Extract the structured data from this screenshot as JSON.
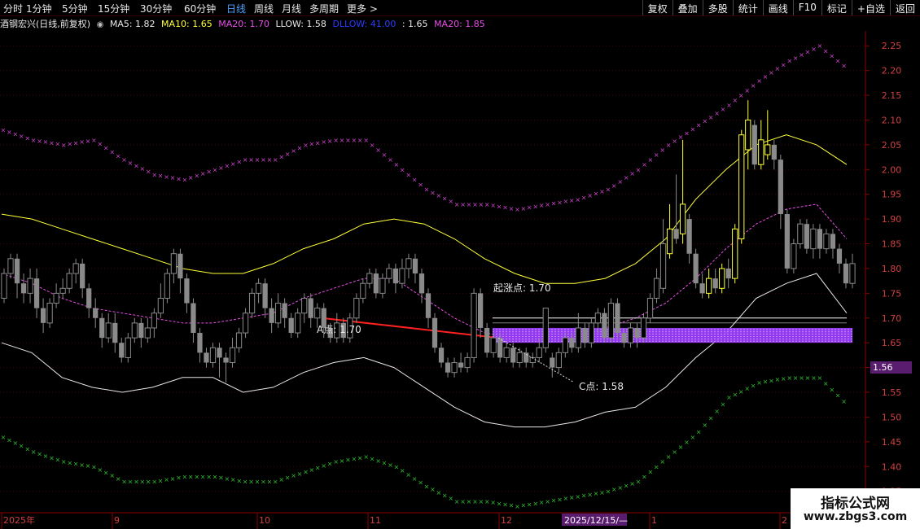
{
  "toolbar": {
    "periods": [
      "分时",
      "1分钟",
      "5分钟",
      "15分钟",
      "30分钟",
      "60分钟",
      "日线",
      "周线",
      "月线",
      "多周期",
      "更多 >"
    ],
    "active_period": "日线",
    "right_buttons": [
      "复权",
      "叠加",
      "多股",
      "统计",
      "画线",
      "F10",
      "标记",
      "+自选",
      "返回"
    ]
  },
  "info": {
    "stock": "酒钢宏兴(日线,前复权)",
    "ma5": "MA5: 1.82",
    "ma10": "MA10: 1.65",
    "ma20": "MA20: 1.70",
    "llow": "LLOW: 1.58",
    "dllow": "DLLOW: 41.00",
    "extra": ": 1.65",
    "ma20b": "MA20: 1.85"
  },
  "colors": {
    "ma5": "#e8e8e8",
    "ma10": "#ffff3a",
    "ma20": "#e84ee8",
    "llow": "#e8e8e8",
    "dllow": "#2b3cff",
    "ma20b": "#e84ee8",
    "up": "#ffff3a",
    "down": "#8a8a8a",
    "red_line": "#ff2020",
    "band": "#9b3cff",
    "axis": "#8b0000"
  },
  "price_axis": {
    "ticks": [
      "2.25",
      "2.20",
      "2.15",
      "2.10",
      "2.05",
      "2.00",
      "1.95",
      "1.90",
      "1.85",
      "1.80",
      "1.75",
      "1.70",
      "1.65",
      "1.60",
      "1.55",
      "1.50",
      "1.45",
      "1.40",
      "1.35"
    ],
    "cursor_value": "1.56"
  },
  "date_axis": {
    "labels": [
      "2025年",
      "9",
      "10",
      "11",
      "12",
      "1",
      "2"
    ],
    "highlight": "2025/12/15/—"
  },
  "annotations": {
    "a_point": "A点: 1.70",
    "c_point": "C点: 1.58",
    "start_point": "起涨点: 1.70"
  },
  "watermark": {
    "line1": "指标公式网",
    "line2": "www.zbgs3.com"
  },
  "chart_data": {
    "type": "candlestick",
    "y_range": [
      1.31,
      2.28
    ],
    "levels": {
      "start_line": 1.7,
      "band_low": 1.65,
      "band_high": 1.68
    },
    "candles": [
      {
        "o": 1.74,
        "c": 1.79,
        "h": 1.8,
        "l": 1.73
      },
      {
        "o": 1.79,
        "c": 1.82,
        "h": 1.83,
        "l": 1.78
      },
      {
        "o": 1.82,
        "c": 1.77,
        "h": 1.83,
        "l": 1.74
      },
      {
        "o": 1.77,
        "c": 1.75,
        "h": 1.79,
        "l": 1.73
      },
      {
        "o": 1.75,
        "c": 1.78,
        "h": 1.8,
        "l": 1.73
      },
      {
        "o": 1.78,
        "c": 1.72,
        "h": 1.8,
        "l": 1.7
      },
      {
        "o": 1.72,
        "c": 1.69,
        "h": 1.74,
        "l": 1.67
      },
      {
        "o": 1.69,
        "c": 1.73,
        "h": 1.74,
        "l": 1.68
      },
      {
        "o": 1.73,
        "c": 1.75,
        "h": 1.77,
        "l": 1.72
      },
      {
        "o": 1.75,
        "c": 1.76,
        "h": 1.78,
        "l": 1.74
      },
      {
        "o": 1.76,
        "c": 1.79,
        "h": 1.8,
        "l": 1.75
      },
      {
        "o": 1.79,
        "c": 1.81,
        "h": 1.82,
        "l": 1.77
      },
      {
        "o": 1.81,
        "c": 1.76,
        "h": 1.82,
        "l": 1.74
      },
      {
        "o": 1.76,
        "c": 1.72,
        "h": 1.77,
        "l": 1.7
      },
      {
        "o": 1.72,
        "c": 1.7,
        "h": 1.74,
        "l": 1.68
      },
      {
        "o": 1.7,
        "c": 1.66,
        "h": 1.71,
        "l": 1.64
      },
      {
        "o": 1.66,
        "c": 1.69,
        "h": 1.71,
        "l": 1.65
      },
      {
        "o": 1.69,
        "c": 1.65,
        "h": 1.71,
        "l": 1.63
      },
      {
        "o": 1.65,
        "c": 1.62,
        "h": 1.66,
        "l": 1.61
      },
      {
        "o": 1.62,
        "c": 1.66,
        "h": 1.67,
        "l": 1.61
      },
      {
        "o": 1.66,
        "c": 1.69,
        "h": 1.7,
        "l": 1.65
      },
      {
        "o": 1.69,
        "c": 1.66,
        "h": 1.7,
        "l": 1.64
      },
      {
        "o": 1.66,
        "c": 1.68,
        "h": 1.7,
        "l": 1.65
      },
      {
        "o": 1.68,
        "c": 1.71,
        "h": 1.72,
        "l": 1.66
      },
      {
        "o": 1.71,
        "c": 1.74,
        "h": 1.77,
        "l": 1.7
      },
      {
        "o": 1.74,
        "c": 1.79,
        "h": 1.8,
        "l": 1.73
      },
      {
        "o": 1.79,
        "c": 1.83,
        "h": 1.84,
        "l": 1.77
      },
      {
        "o": 1.83,
        "c": 1.78,
        "h": 1.84,
        "l": 1.75
      },
      {
        "o": 1.78,
        "c": 1.73,
        "h": 1.79,
        "l": 1.71
      },
      {
        "o": 1.73,
        "c": 1.67,
        "h": 1.74,
        "l": 1.65
      },
      {
        "o": 1.67,
        "c": 1.63,
        "h": 1.68,
        "l": 1.61
      },
      {
        "o": 1.63,
        "c": 1.61,
        "h": 1.64,
        "l": 1.6
      },
      {
        "o": 1.61,
        "c": 1.64,
        "h": 1.65,
        "l": 1.6
      },
      {
        "o": 1.64,
        "c": 1.62,
        "h": 1.65,
        "l": 1.58
      },
      {
        "o": 1.62,
        "c": 1.61,
        "h": 1.63,
        "l": 1.57
      },
      {
        "o": 1.61,
        "c": 1.64,
        "h": 1.66,
        "l": 1.6
      },
      {
        "o": 1.64,
        "c": 1.67,
        "h": 1.68,
        "l": 1.63
      },
      {
        "o": 1.67,
        "c": 1.71,
        "h": 1.72,
        "l": 1.66
      },
      {
        "o": 1.71,
        "c": 1.75,
        "h": 1.76,
        "l": 1.7
      },
      {
        "o": 1.75,
        "c": 1.77,
        "h": 1.78,
        "l": 1.73
      },
      {
        "o": 1.77,
        "c": 1.72,
        "h": 1.78,
        "l": 1.7
      },
      {
        "o": 1.72,
        "c": 1.69,
        "h": 1.74,
        "l": 1.67
      },
      {
        "o": 1.69,
        "c": 1.73,
        "h": 1.75,
        "l": 1.68
      },
      {
        "o": 1.73,
        "c": 1.7,
        "h": 1.74,
        "l": 1.68
      },
      {
        "o": 1.7,
        "c": 1.67,
        "h": 1.71,
        "l": 1.66
      },
      {
        "o": 1.67,
        "c": 1.71,
        "h": 1.72,
        "l": 1.66
      },
      {
        "o": 1.71,
        "c": 1.74,
        "h": 1.75,
        "l": 1.69
      },
      {
        "o": 1.74,
        "c": 1.7,
        "h": 1.75,
        "l": 1.68
      },
      {
        "o": 1.7,
        "c": 1.72,
        "h": 1.73,
        "l": 1.68
      },
      {
        "o": 1.72,
        "c": 1.68,
        "h": 1.73,
        "l": 1.66
      },
      {
        "o": 1.68,
        "c": 1.66,
        "h": 1.69,
        "l": 1.65
      },
      {
        "o": 1.66,
        "c": 1.69,
        "h": 1.71,
        "l": 1.65
      },
      {
        "o": 1.69,
        "c": 1.66,
        "h": 1.7,
        "l": 1.65
      },
      {
        "o": 1.66,
        "c": 1.7,
        "h": 1.71,
        "l": 1.65
      },
      {
        "o": 1.7,
        "c": 1.74,
        "h": 1.75,
        "l": 1.69
      },
      {
        "o": 1.74,
        "c": 1.77,
        "h": 1.78,
        "l": 1.73
      },
      {
        "o": 1.77,
        "c": 1.79,
        "h": 1.8,
        "l": 1.76
      },
      {
        "o": 1.79,
        "c": 1.75,
        "h": 1.8,
        "l": 1.74
      },
      {
        "o": 1.75,
        "c": 1.78,
        "h": 1.79,
        "l": 1.74
      },
      {
        "o": 1.78,
        "c": 1.8,
        "h": 1.81,
        "l": 1.77
      },
      {
        "o": 1.8,
        "c": 1.77,
        "h": 1.81,
        "l": 1.75
      },
      {
        "o": 1.77,
        "c": 1.8,
        "h": 1.82,
        "l": 1.76
      },
      {
        "o": 1.8,
        "c": 1.82,
        "h": 1.83,
        "l": 1.78
      },
      {
        "o": 1.82,
        "c": 1.79,
        "h": 1.83,
        "l": 1.77
      },
      {
        "o": 1.79,
        "c": 1.75,
        "h": 1.8,
        "l": 1.73
      },
      {
        "o": 1.75,
        "c": 1.7,
        "h": 1.76,
        "l": 1.68
      },
      {
        "o": 1.7,
        "c": 1.64,
        "h": 1.71,
        "l": 1.63
      },
      {
        "o": 1.64,
        "c": 1.61,
        "h": 1.65,
        "l": 1.6
      },
      {
        "o": 1.61,
        "c": 1.59,
        "h": 1.62,
        "l": 1.58
      },
      {
        "o": 1.59,
        "c": 1.61,
        "h": 1.62,
        "l": 1.58
      },
      {
        "o": 1.61,
        "c": 1.6,
        "h": 1.63,
        "l": 1.59
      },
      {
        "o": 1.6,
        "c": 1.62,
        "h": 1.63,
        "l": 1.59
      },
      {
        "o": 1.62,
        "c": 1.75,
        "h": 1.76,
        "l": 1.61
      },
      {
        "o": 1.75,
        "c": 1.68,
        "h": 1.76,
        "l": 1.66
      },
      {
        "o": 1.68,
        "c": 1.63,
        "h": 1.69,
        "l": 1.62
      },
      {
        "o": 1.63,
        "c": 1.66,
        "h": 1.67,
        "l": 1.62
      },
      {
        "o": 1.66,
        "c": 1.62,
        "h": 1.67,
        "l": 1.61
      },
      {
        "o": 1.62,
        "c": 1.64,
        "h": 1.65,
        "l": 1.61
      },
      {
        "o": 1.64,
        "c": 1.61,
        "h": 1.65,
        "l": 1.6
      },
      {
        "o": 1.61,
        "c": 1.63,
        "h": 1.64,
        "l": 1.6
      },
      {
        "o": 1.63,
        "c": 1.61,
        "h": 1.64,
        "l": 1.6
      },
      {
        "o": 1.61,
        "c": 1.62,
        "h": 1.63,
        "l": 1.6
      },
      {
        "o": 1.62,
        "c": 1.64,
        "h": 1.66,
        "l": 1.61
      },
      {
        "o": 1.64,
        "c": 1.72,
        "h": 1.72,
        "l": 1.63
      },
      {
        "o": 1.62,
        "c": 1.6,
        "h": 1.63,
        "l": 1.58
      },
      {
        "o": 1.6,
        "c": 1.63,
        "h": 1.64,
        "l": 1.59
      },
      {
        "o": 1.63,
        "c": 1.66,
        "h": 1.67,
        "l": 1.62
      },
      {
        "o": 1.66,
        "c": 1.64,
        "h": 1.67,
        "l": 1.63
      },
      {
        "o": 1.64,
        "c": 1.68,
        "h": 1.71,
        "l": 1.63
      },
      {
        "o": 1.68,
        "c": 1.65,
        "h": 1.69,
        "l": 1.64
      },
      {
        "o": 1.65,
        "c": 1.69,
        "h": 1.7,
        "l": 1.64
      },
      {
        "o": 1.69,
        "c": 1.71,
        "h": 1.72,
        "l": 1.67
      },
      {
        "o": 1.71,
        "c": 1.66,
        "h": 1.72,
        "l": 1.65
      },
      {
        "o": 1.66,
        "c": 1.73,
        "h": 1.74,
        "l": 1.65
      },
      {
        "o": 1.73,
        "c": 1.67,
        "h": 1.74,
        "l": 1.66
      },
      {
        "o": 1.67,
        "c": 1.65,
        "h": 1.68,
        "l": 1.64
      },
      {
        "o": 1.65,
        "c": 1.68,
        "h": 1.69,
        "l": 1.64
      },
      {
        "o": 1.68,
        "c": 1.66,
        "h": 1.69,
        "l": 1.64
      },
      {
        "o": 1.66,
        "c": 1.7,
        "h": 1.71,
        "l": 1.65
      },
      {
        "o": 1.7,
        "c": 1.74,
        "h": 1.75,
        "l": 1.69
      },
      {
        "o": 1.74,
        "c": 1.78,
        "h": 1.8,
        "l": 1.73
      },
      {
        "o": 1.76,
        "c": 1.85,
        "h": 1.9,
        "l": 1.75
      },
      {
        "o": 1.83,
        "c": 1.88,
        "h": 1.93,
        "l": 1.82
      },
      {
        "o": 1.88,
        "c": 1.86,
        "h": 1.99,
        "l": 1.85
      },
      {
        "o": 1.87,
        "c": 1.93,
        "h": 2.06,
        "l": 1.85
      },
      {
        "o": 1.9,
        "c": 1.83,
        "h": 1.91,
        "l": 1.81
      },
      {
        "o": 1.83,
        "c": 1.77,
        "h": 1.84,
        "l": 1.76
      },
      {
        "o": 1.77,
        "c": 1.75,
        "h": 1.79,
        "l": 1.74
      },
      {
        "o": 1.75,
        "c": 1.78,
        "h": 1.8,
        "l": 1.74
      },
      {
        "o": 1.78,
        "c": 1.76,
        "h": 1.8,
        "l": 1.75
      },
      {
        "o": 1.76,
        "c": 1.8,
        "h": 1.81,
        "l": 1.75
      },
      {
        "o": 1.8,
        "c": 1.78,
        "h": 1.82,
        "l": 1.76
      },
      {
        "o": 1.78,
        "c": 1.88,
        "h": 1.89,
        "l": 1.77
      },
      {
        "o": 1.86,
        "c": 2.07,
        "h": 2.08,
        "l": 1.85
      },
      {
        "o": 2.04,
        "c": 2.1,
        "h": 2.14,
        "l": 2.0
      },
      {
        "o": 2.09,
        "c": 2.01,
        "h": 2.1,
        "l": 2.0
      },
      {
        "o": 2.01,
        "c": 2.06,
        "h": 2.1,
        "l": 2.0
      },
      {
        "o": 2.03,
        "c": 2.05,
        "h": 2.12,
        "l": 2.02
      },
      {
        "o": 2.05,
        "c": 2.02,
        "h": 2.06,
        "l": 2.0
      },
      {
        "o": 2.02,
        "c": 1.91,
        "h": 2.03,
        "l": 1.88
      },
      {
        "o": 1.91,
        "c": 1.8,
        "h": 1.92,
        "l": 1.79
      },
      {
        "o": 1.8,
        "c": 1.85,
        "h": 1.86,
        "l": 1.79
      },
      {
        "o": 1.85,
        "c": 1.89,
        "h": 1.9,
        "l": 1.84
      },
      {
        "o": 1.89,
        "c": 1.84,
        "h": 1.9,
        "l": 1.83
      },
      {
        "o": 1.84,
        "c": 1.88,
        "h": 1.89,
        "l": 1.82
      },
      {
        "o": 1.88,
        "c": 1.84,
        "h": 1.89,
        "l": 1.82
      },
      {
        "o": 1.84,
        "c": 1.87,
        "h": 1.88,
        "l": 1.83
      },
      {
        "o": 1.87,
        "c": 1.84,
        "h": 1.88,
        "l": 1.82
      },
      {
        "o": 1.84,
        "c": 1.81,
        "h": 1.85,
        "l": 1.79
      },
      {
        "o": 1.81,
        "c": 1.77,
        "h": 1.82,
        "l": 1.76
      },
      {
        "o": 1.77,
        "c": 1.81,
        "h": 1.83,
        "l": 1.76
      }
    ],
    "ma10_yellow": [
      1.91,
      1.9,
      1.88,
      1.86,
      1.84,
      1.82,
      1.8,
      1.79,
      1.79,
      1.81,
      1.84,
      1.86,
      1.89,
      1.9,
      1.89,
      1.86,
      1.82,
      1.79,
      1.77,
      1.77,
      1.78,
      1.81,
      1.86,
      1.94,
      2.0,
      2.05,
      2.07,
      2.05,
      2.01
    ],
    "ma20_purple_dash": [
      1.79,
      1.77,
      1.74,
      1.72,
      1.71,
      1.7,
      1.69,
      1.69,
      1.7,
      1.71,
      1.74,
      1.76,
      1.78,
      1.78,
      1.74,
      1.7,
      1.67,
      1.66,
      1.65,
      1.66,
      1.68,
      1.7,
      1.73,
      1.78,
      1.84,
      1.89,
      1.92,
      1.93,
      1.86
    ],
    "llow_white": [
      1.65,
      1.63,
      1.58,
      1.56,
      1.55,
      1.56,
      1.58,
      1.58,
      1.55,
      1.56,
      1.59,
      1.61,
      1.62,
      1.6,
      1.56,
      1.52,
      1.49,
      1.48,
      1.48,
      1.49,
      1.51,
      1.52,
      1.56,
      1.62,
      1.67,
      1.74,
      1.77,
      1.79,
      1.71
    ],
    "upper_cross": [
      2.08,
      2.06,
      2.05,
      2.06,
      2.02,
      1.99,
      1.98,
      2.0,
      2.02,
      2.02,
      2.05,
      2.06,
      2.06,
      2.01,
      1.96,
      1.93,
      1.93,
      1.92,
      1.93,
      1.94,
      1.96,
      2.0,
      2.05,
      2.09,
      2.13,
      2.18,
      2.22,
      2.25,
      2.2
    ],
    "lower_cross": [
      1.46,
      1.43,
      1.41,
      1.4,
      1.37,
      1.37,
      1.38,
      1.38,
      1.37,
      1.37,
      1.39,
      1.41,
      1.42,
      1.4,
      1.36,
      1.33,
      1.33,
      1.32,
      1.33,
      1.34,
      1.35,
      1.37,
      1.42,
      1.47,
      1.54,
      1.57,
      1.58,
      1.58,
      1.52
    ],
    "red_trend": {
      "from": [
        1.7,
        0.4
      ],
      "to": [
        1.66,
        0.6
      ]
    }
  }
}
